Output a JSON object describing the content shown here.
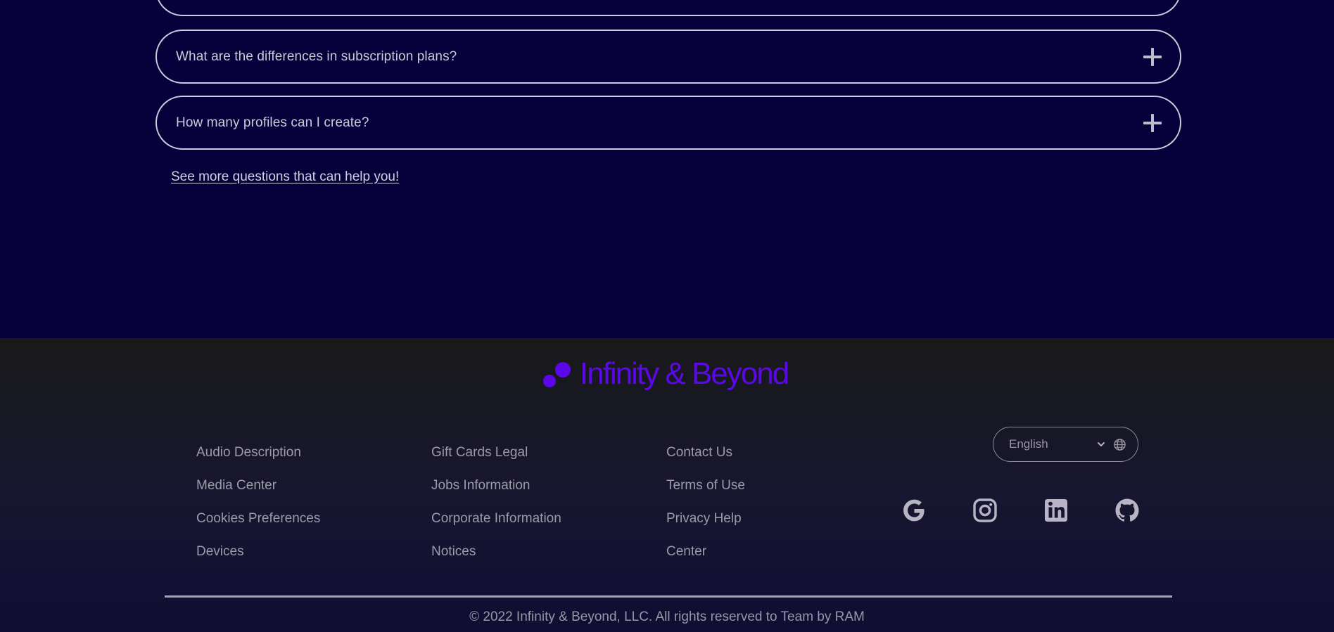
{
  "faq": {
    "questions": [
      "What are the differences in subscription plans?",
      "How many profiles can I create?"
    ],
    "see_more": "See more questions that can help you!"
  },
  "footer": {
    "brand": "Infinity & Beyond",
    "columns": [
      [
        "Audio Description",
        "Media Center",
        "Cookies Preferences",
        "Devices"
      ],
      [
        "Gift Cards Legal",
        "Jobs Information",
        "Corporate Information",
        "Notices"
      ],
      [
        "Contact Us",
        "Terms of Use",
        "Privacy Help",
        "Center"
      ]
    ],
    "language": "English",
    "social_icons": [
      "google-icon",
      "instagram-icon",
      "linkedin-icon",
      "github-icon"
    ],
    "copyright": "© 2022 Infinity & Beyond, LLC. All rights reserved to Team by RAM"
  },
  "colors": {
    "background": "#06013a",
    "brand": "#5a08e8",
    "footer": "#191919"
  }
}
